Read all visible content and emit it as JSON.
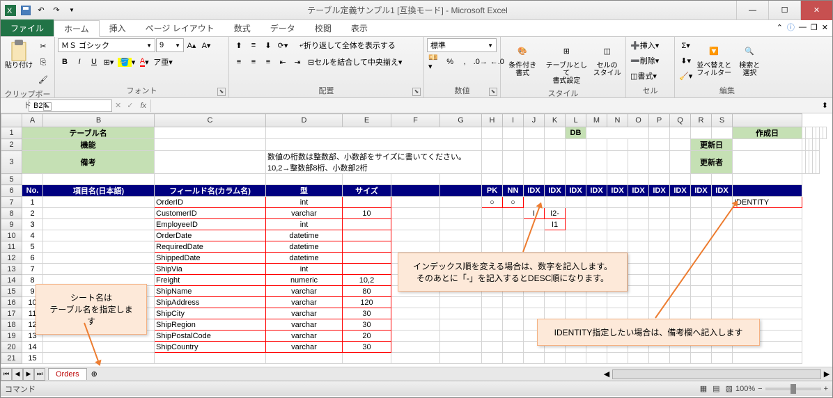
{
  "window": {
    "title": "テーブル定義サンプル1 [互換モード] - Microsoft Excel"
  },
  "tabs": {
    "file": "ファイル",
    "list": [
      "ホーム",
      "挿入",
      "ページ レイアウト",
      "数式",
      "データ",
      "校閲",
      "表示"
    ],
    "active": 0
  },
  "ribbon": {
    "clipboard": {
      "label": "クリップボード",
      "paste": "貼り付け"
    },
    "font": {
      "label": "フォント",
      "name": "ＭＳ ゴシック",
      "size": "9"
    },
    "align": {
      "label": "配置",
      "wrap": "折り返して全体を表示する",
      "merge": "セルを結合して中央揃え"
    },
    "number": {
      "label": "数値",
      "format": "標準"
    },
    "styles": {
      "label": "スタイル",
      "cond": "条件付き\n書式",
      "table": "テーブルとして\n書式設定",
      "cell": "セルの\nスタイル"
    },
    "cells": {
      "label": "セル",
      "insert": "挿入",
      "delete": "削除",
      "format": "書式"
    },
    "editing": {
      "label": "編集",
      "sort": "並べ替えと\nフィルター",
      "find": "検索と\n選択"
    }
  },
  "namebox": {
    "ref": "B24"
  },
  "columns": [
    "",
    "A",
    "B",
    "C",
    "D",
    "E",
    "F",
    "G",
    "H",
    "I",
    "J",
    "K",
    "L",
    "M",
    "N",
    "O",
    "P",
    "Q",
    "R",
    "S"
  ],
  "header_rows": {
    "r1_b": "テーブル名",
    "r1_h": "DB",
    "r1_n": "作成日",
    "r2_b": "機能",
    "r2_n": "更新日",
    "r3_b": "備考",
    "r3_c": "数値の桁数は整数部、小数部をサイズに書いてください。\n10,2→整数部8桁、小数部2桁",
    "r3_n": "更新者"
  },
  "field_header": {
    "no": "No.",
    "jname": "項目名(日本語)",
    "colname": "フィールド名(カラム名)",
    "type": "型",
    "size": "サイズ",
    "pk": "PK",
    "nn": "NN",
    "idx": "IDX"
  },
  "rows": [
    {
      "no": "1",
      "col": "OrderID",
      "type": "int",
      "size": "",
      "pk": "○",
      "nn": "○",
      "note": "IDENTITY"
    },
    {
      "no": "2",
      "col": "CustomerID",
      "type": "varchar",
      "size": "10",
      "idx_j": "I",
      "idx_k": "I2-"
    },
    {
      "no": "3",
      "col": "EmployeeID",
      "type": "int",
      "size": "",
      "idx_k": "I1"
    },
    {
      "no": "4",
      "col": "OrderDate",
      "type": "datetime",
      "size": ""
    },
    {
      "no": "5",
      "col": "RequiredDate",
      "type": "datetime",
      "size": ""
    },
    {
      "no": "6",
      "col": "ShippedDate",
      "type": "datetime",
      "size": ""
    },
    {
      "no": "7",
      "col": "ShipVia",
      "type": "int",
      "size": ""
    },
    {
      "no": "8",
      "col": "Freight",
      "type": "numeric",
      "size": "10,2"
    },
    {
      "no": "9",
      "col": "ShipName",
      "type": "varchar",
      "size": "80"
    },
    {
      "no": "10",
      "col": "ShipAddress",
      "type": "varchar",
      "size": "120"
    },
    {
      "no": "11",
      "col": "ShipCity",
      "type": "varchar",
      "size": "30"
    },
    {
      "no": "12",
      "col": "ShipRegion",
      "type": "varchar",
      "size": "30"
    },
    {
      "no": "13",
      "col": "ShipPostalCode",
      "type": "varchar",
      "size": "20"
    },
    {
      "no": "14",
      "col": "ShipCountry",
      "type": "varchar",
      "size": "30"
    },
    {
      "no": "15",
      "col": "",
      "type": "",
      "size": ""
    }
  ],
  "callouts": {
    "sheet": "シート名は\nテーブル名を指定します",
    "index": "インデックス順を変える場合は、数字を記入します。\nそのあとに「-」を記入するとDESC順になります。",
    "identity": "IDENTITY指定したい場合は、備考欄へ記入します"
  },
  "sheet_tab": "Orders",
  "status": {
    "cmd": "コマンド",
    "zoom": "100%"
  }
}
